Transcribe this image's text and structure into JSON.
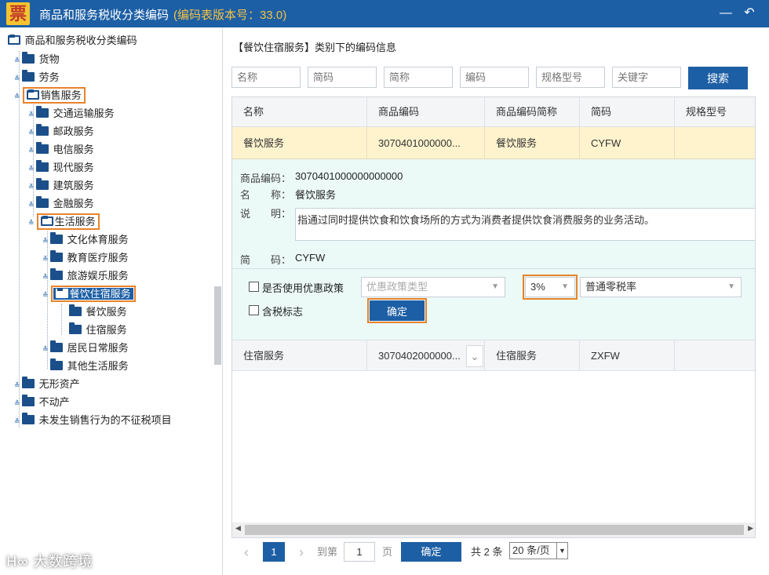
{
  "titlebar": {
    "logo": "票",
    "title": "商品和服务税收分类编码",
    "version": "(编码表版本号：33.0)",
    "minimize_icon": "minimize-icon",
    "back_icon": "back-arrow-icon"
  },
  "tree": {
    "root": "商品和服务税收分类编码",
    "items": [
      {
        "label": "货物"
      },
      {
        "label": "劳务"
      },
      {
        "label": "销售服务"
      },
      {
        "label": "交通运输服务"
      },
      {
        "label": "邮政服务"
      },
      {
        "label": "电信服务"
      },
      {
        "label": "现代服务"
      },
      {
        "label": "建筑服务"
      },
      {
        "label": "金融服务"
      },
      {
        "label": "生活服务"
      },
      {
        "label": "文化体育服务"
      },
      {
        "label": "教育医疗服务"
      },
      {
        "label": "旅游娱乐服务"
      },
      {
        "label": "餐饮住宿服务"
      },
      {
        "label": "餐饮服务"
      },
      {
        "label": "住宿服务"
      },
      {
        "label": "居民日常服务"
      },
      {
        "label": "其他生活服务"
      },
      {
        "label": "无形资产"
      },
      {
        "label": "不动产"
      },
      {
        "label": "未发生销售行为的不征税项目"
      }
    ]
  },
  "panel": {
    "title": "【餐饮住宿服务】类别下的编码信息",
    "search": {
      "placeholders": [
        "名称",
        "简码",
        "简称",
        "编码",
        "规格型号",
        "关键字"
      ],
      "button": "搜索"
    },
    "columns": [
      "名称",
      "商品编码",
      "商品编码简称",
      "简码",
      "规格型号"
    ],
    "rows": [
      {
        "name": "餐饮服务",
        "code": "3070401000000...",
        "short": "餐饮服务",
        "abbr": "CYFW",
        "spec": ""
      },
      {
        "name": "住宿服务",
        "code": "3070402000000...",
        "short": "住宿服务",
        "abbr": "ZXFW",
        "spec": ""
      }
    ],
    "detail": {
      "code_label": "商品编码：",
      "code_value": "3070401000000000000",
      "name_label": "名　　称：",
      "name_value": "餐饮服务",
      "desc_label": "说　　明：",
      "desc_value": "指通过同时提供饮食和饮食场所的方式为消费者提供饮食消费服务的业务活动。",
      "abbr_label": "简　　码：",
      "abbr_value": "CYFW",
      "use_policy_label": "是否使用优惠政策",
      "policy_type_placeholder": "优惠政策类型",
      "tax_rate": "3%",
      "zero_rate": "普通零税率",
      "tax_included_label": "含税标志",
      "confirm": "确定"
    },
    "pager": {
      "prev": "‹",
      "page": "1",
      "next": "›",
      "goto_label": "到第",
      "goto_value": "1",
      "page_unit": "页",
      "confirm": "确定",
      "total": "共 2 条",
      "page_size": "20 条/页"
    }
  },
  "watermark": "大数跨境",
  "colors": {
    "titlebar": "#1d5fa5",
    "highlight": "#e8832b",
    "selected_row": "#fef3cd",
    "detail_bg": "#ebf9f7"
  }
}
